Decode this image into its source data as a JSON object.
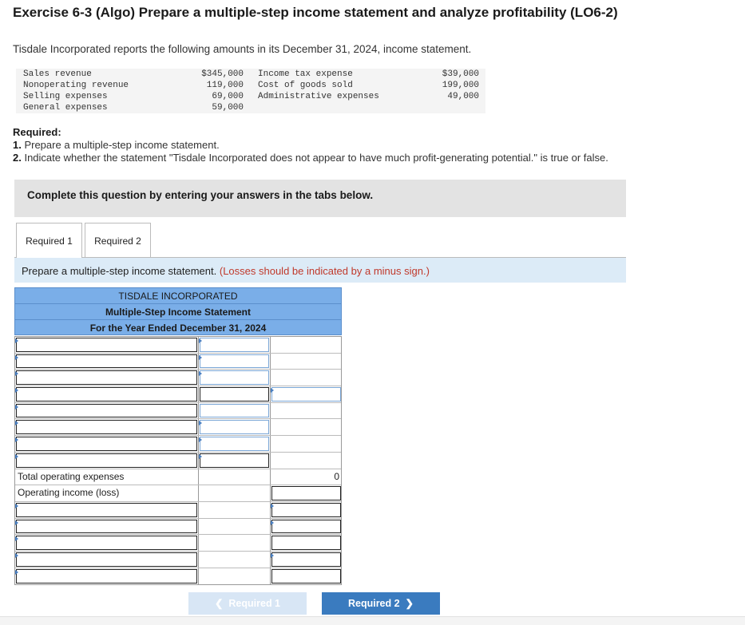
{
  "title": "Exercise 6-3 (Algo) Prepare a multiple-step income statement and analyze profitability (LO6-2)",
  "intro": "Tisdale Incorporated reports the following amounts in its December 31, 2024, income statement.",
  "amounts": [
    {
      "l1": "Sales revenue",
      "v1": "$345,000",
      "l2": "Income tax expense",
      "v2": "$39,000"
    },
    {
      "l1": "Nonoperating revenue",
      "v1": "119,000",
      "l2": "Cost of goods sold",
      "v2": "199,000"
    },
    {
      "l1": "Selling expenses",
      "v1": "69,000",
      "l2": "Administrative expenses",
      "v2": "49,000"
    },
    {
      "l1": "General expenses",
      "v1": "59,000",
      "l2": "",
      "v2": ""
    }
  ],
  "required": {
    "heading": "Required:",
    "n1": "1.",
    "item1": " Prepare a multiple-step income statement.",
    "n2": "2.",
    "item2": " Indicate whether the statement \"Tisdale Incorporated does not appear to have much profit-generating potential.\" is true or false."
  },
  "instruction_box": "Complete this question by entering your answers in the tabs below.",
  "tabs": [
    "Required 1",
    "Required 2"
  ],
  "prompt": "Prepare a multiple-step income statement.",
  "prompt_note": "(Losses should be indicated by a minus sign.)",
  "statement": {
    "company": "TISDALE INCORPORATED",
    "name": "Multiple-Step Income Statement",
    "period": "For the Year Ended December 31, 2024",
    "total_operating_expenses_label": "Total operating expenses",
    "total_operating_expenses_value": "0",
    "operating_income_label": "Operating income (loss)"
  },
  "nav": {
    "prev": "Required 1",
    "next": "Required 2"
  }
}
